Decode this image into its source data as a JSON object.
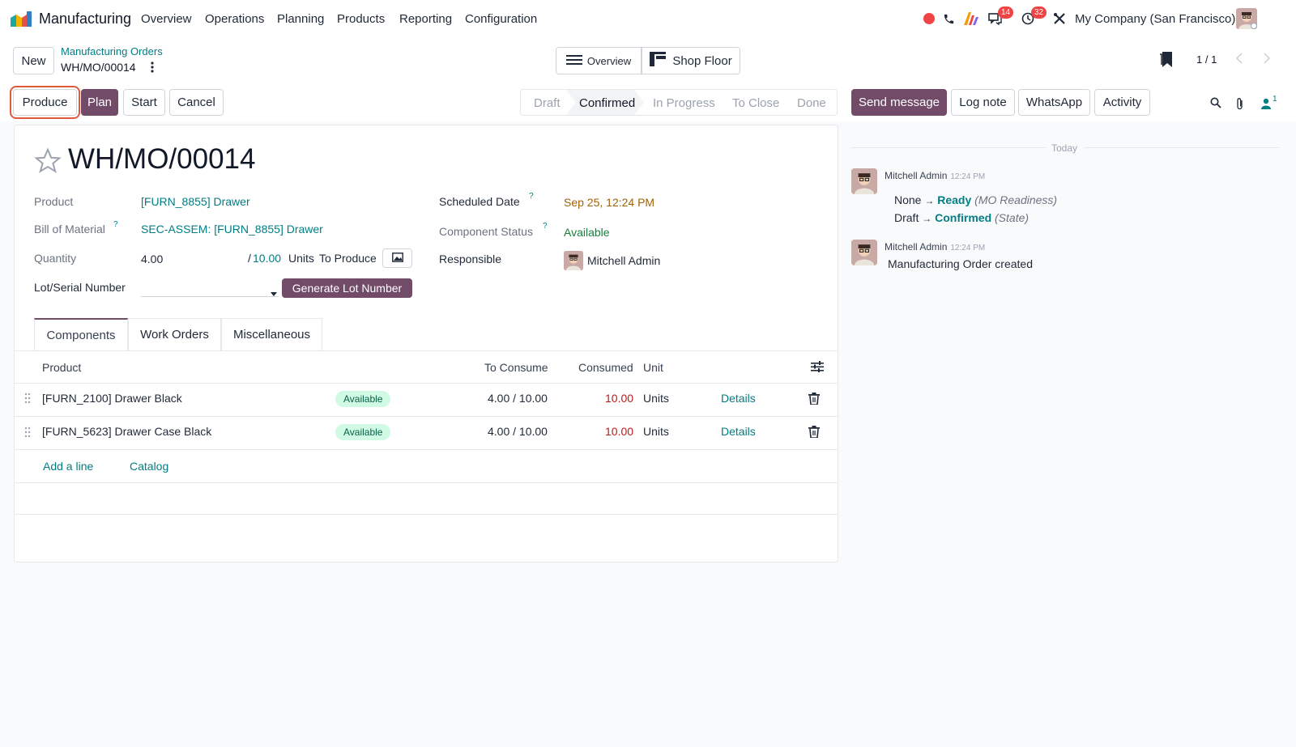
{
  "navbar": {
    "app_name": "Manufacturing",
    "menu": [
      "Overview",
      "Operations",
      "Planning",
      "Products",
      "Reporting",
      "Configuration"
    ],
    "messages_badge": "14",
    "activities_badge": "32",
    "company": "My Company (San Francisco)"
  },
  "control": {
    "new_label": "New",
    "breadcrumb_parent": "Manufacturing Orders",
    "record_name": "WH/MO/00014",
    "overview_label": "Overview",
    "shop_floor_label": "Shop Floor",
    "pager": "1 / 1",
    "actions": {
      "produce": "Produce",
      "plan": "Plan",
      "start": "Start",
      "cancel": "Cancel"
    },
    "stages": [
      "Draft",
      "Confirmed",
      "In Progress",
      "To Close",
      "Done"
    ],
    "active_stage": "Confirmed"
  },
  "form": {
    "title": "WH/MO/00014",
    "product_label": "Product",
    "product_value": "[FURN_8855] Drawer",
    "bom_label": "Bill of Material",
    "bom_value": "SEC-ASSEM: [FURN_8855] Drawer",
    "quantity_label": "Quantity",
    "quantity_value": "4.00",
    "quantity_total": "10.00",
    "quantity_sep": "/",
    "quantity_unit": "Units",
    "to_produce": "To Produce",
    "lot_label": "Lot/Serial Number",
    "generate_lot": "Generate Lot Number",
    "scheduled_label": "Scheduled Date",
    "scheduled_value": "Sep 25, 12:24 PM",
    "component_status_label": "Component Status",
    "component_status_value": "Available",
    "responsible_label": "Responsible",
    "responsible_value": "Mitchell Admin",
    "help_mark": "?"
  },
  "tabs": [
    "Components",
    "Work Orders",
    "Miscellaneous"
  ],
  "table": {
    "headers": {
      "product": "Product",
      "to_consume": "To Consume",
      "consumed": "Consumed",
      "unit": "Unit"
    },
    "rows": [
      {
        "product": "[FURN_2100] Drawer Black",
        "status": "Available",
        "to_consume": "4.00 / 10.00",
        "consumed": "10.00",
        "unit": "Units",
        "details": "Details"
      },
      {
        "product": "[FURN_5623] Drawer Case Black",
        "status": "Available",
        "to_consume": "4.00 / 10.00",
        "consumed": "10.00",
        "unit": "Units",
        "details": "Details"
      }
    ],
    "add_line": "Add a line",
    "catalog": "Catalog"
  },
  "chatter": {
    "send_message": "Send message",
    "log_note": "Log note",
    "whatsapp": "WhatsApp",
    "activity": "Activity",
    "followers_count": "1",
    "date_separator": "Today",
    "messages": [
      {
        "author": "Mitchell Admin",
        "time": "12:24 PM",
        "changes": [
          {
            "old": "None",
            "arrow": "→",
            "new": "Ready",
            "field": "(MO Readiness)"
          },
          {
            "old": "Draft",
            "arrow": "→",
            "new": "Confirmed",
            "field": "(State)"
          }
        ]
      },
      {
        "author": "Mitchell Admin",
        "time": "12:24 PM",
        "body": "Manufacturing Order created"
      }
    ]
  },
  "colors": {
    "primary": "#714b67",
    "teal": "#017e84",
    "danger": "#b91c1c",
    "warning": "#a16207",
    "success": "#15803d",
    "highlight": "#e05a3a"
  }
}
